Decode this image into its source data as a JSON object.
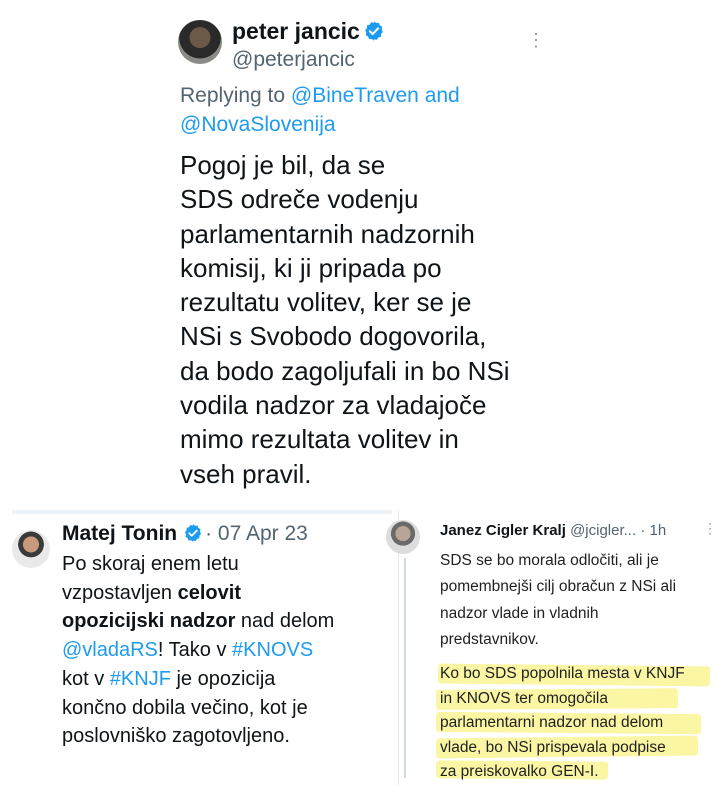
{
  "top_tweet": {
    "name": "peter jancic",
    "handle": "@peterjancic",
    "replying_to_prefix": "Replying to",
    "replying_to_1": "@BineTraven",
    "replying_to_and": "and",
    "replying_to_2": "@NovaSlovenija",
    "lines": [
      "Pogoj je bil, da se",
      "SDS odreče vodenju",
      "parlamentarnih nadzornih",
      "komisij, ki ji pripada po",
      "rezultatu volitev, ker se je",
      "NSi s Svobodo dogovorila,",
      "da bodo zagoljufali in bo NSi",
      "vodila nadzor za vladajoče",
      "mimo rezultata volitev in",
      "vseh pravil."
    ]
  },
  "bottom_left_tweet": {
    "name": "Matej Tonin",
    "date": "· 07 Apr 23",
    "line1": "Po skoraj enem letu",
    "line2_plain": "vzpostavljen ",
    "line2_bold": "celovit",
    "line3_bold": "opozicijski nadzor",
    "line3_plain": " nad delom",
    "line4_link1": "@vladaRS",
    "line4_mid": "! Tako v ",
    "line4_link2": "#KNOVS",
    "line5_pre": "kot v ",
    "line5_link": "#KNJF",
    "line5_post": " je opozicija",
    "line6": "končno dobila večino, kot je",
    "line7": "poslovniško zagotovljeno."
  },
  "bottom_right_tweet": {
    "name": "Janez Cigler Kralj",
    "handle": "@jcigler...",
    "time": "· 1h",
    "para1": [
      "SDS se bo morala odločiti, ali je",
      "pomembnejši cilj obračun z NSi ali",
      "nadzor vlade in vladnih",
      "predstavnikov."
    ],
    "para2": [
      "Ko bo SDS popolnila mesta v KNJF",
      "in KNOVS ter omogočila",
      "parlamentarni nadzor nad delom",
      "vlade, bo NSi prispevala podpise",
      "za preiskovalko GEN-I."
    ]
  },
  "colors": {
    "accent": "#1d9bf0",
    "highlight": "#fbf59a",
    "text": "#0f1419",
    "secondary": "#536471"
  }
}
